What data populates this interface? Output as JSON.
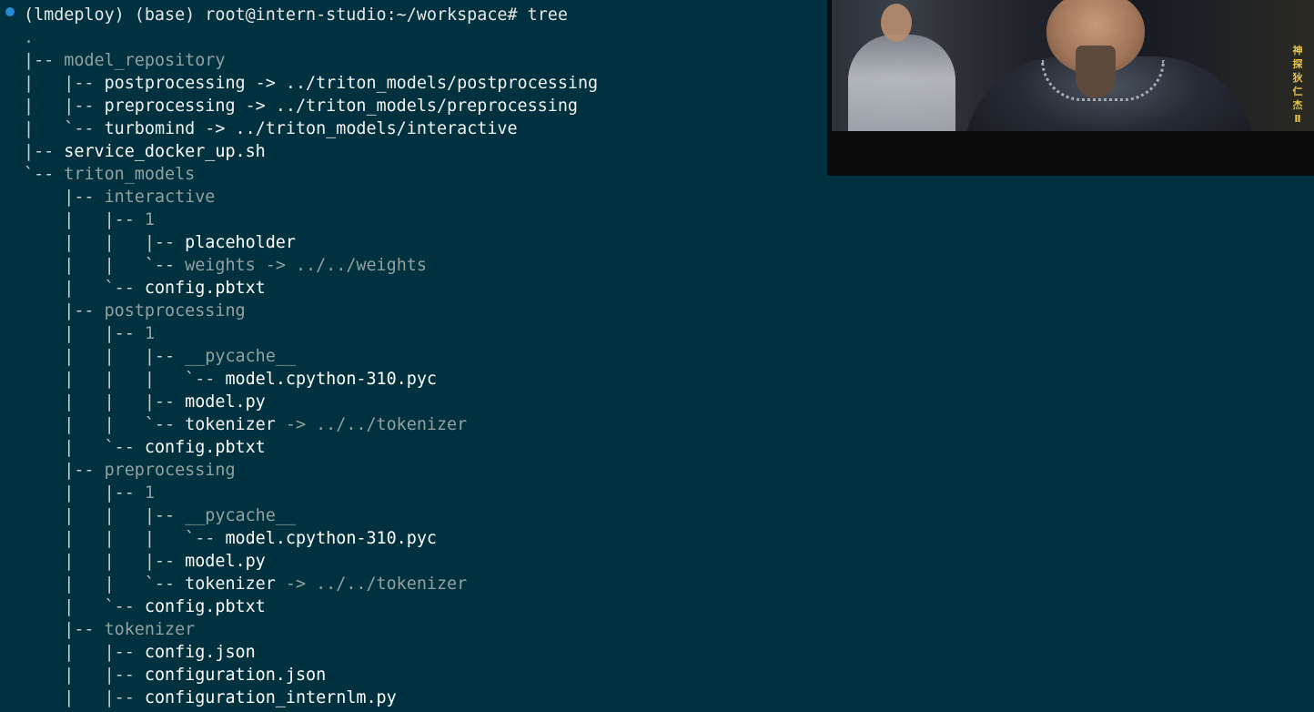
{
  "terminal": {
    "prompt": "(lmdeploy) (base) root@intern-studio:~/workspace#",
    "command": "tree",
    "lines": [
      [
        {
          "t": ".",
          "c": "dot"
        }
      ],
      [
        {
          "t": "|-- ",
          "c": "branch"
        },
        {
          "t": "model_repository",
          "c": "dir"
        }
      ],
      [
        {
          "t": "|   |-- ",
          "c": "branch"
        },
        {
          "t": "postprocessing",
          "c": "link"
        },
        {
          "t": " -> ",
          "c": "link"
        },
        {
          "t": "../triton_models/postprocessing",
          "c": "link"
        }
      ],
      [
        {
          "t": "|   |-- ",
          "c": "branch"
        },
        {
          "t": "preprocessing",
          "c": "link"
        },
        {
          "t": " -> ",
          "c": "link"
        },
        {
          "t": "../triton_models/preprocessing",
          "c": "link"
        }
      ],
      [
        {
          "t": "|   `-- ",
          "c": "branch"
        },
        {
          "t": "turbomind",
          "c": "link"
        },
        {
          "t": " -> ",
          "c": "link"
        },
        {
          "t": "../triton_models/interactive",
          "c": "link"
        }
      ],
      [
        {
          "t": "|-- ",
          "c": "branch"
        },
        {
          "t": "service_docker_up.sh",
          "c": "file"
        }
      ],
      [
        {
          "t": "`-- ",
          "c": "branch"
        },
        {
          "t": "triton_models",
          "c": "dir"
        }
      ],
      [
        {
          "t": "    |-- ",
          "c": "branch"
        },
        {
          "t": "interactive",
          "c": "dir"
        }
      ],
      [
        {
          "t": "    |   |-- ",
          "c": "branch"
        },
        {
          "t": "1",
          "c": "dir"
        }
      ],
      [
        {
          "t": "    |   |   |-- ",
          "c": "branch"
        },
        {
          "t": "placeholder",
          "c": "file"
        }
      ],
      [
        {
          "t": "    |   |   `-- ",
          "c": "branch"
        },
        {
          "t": "weights",
          "c": "dir"
        },
        {
          "t": " -> ",
          "c": "dir"
        },
        {
          "t": "../../weights",
          "c": "target"
        }
      ],
      [
        {
          "t": "    |   `-- ",
          "c": "branch"
        },
        {
          "t": "config.pbtxt",
          "c": "file"
        }
      ],
      [
        {
          "t": "    |-- ",
          "c": "branch"
        },
        {
          "t": "postprocessing",
          "c": "dir"
        }
      ],
      [
        {
          "t": "    |   |-- ",
          "c": "branch"
        },
        {
          "t": "1",
          "c": "dir"
        }
      ],
      [
        {
          "t": "    |   |   |-- ",
          "c": "branch"
        },
        {
          "t": "__pycache__",
          "c": "dir"
        }
      ],
      [
        {
          "t": "    |   |   |   `-- ",
          "c": "branch"
        },
        {
          "t": "model.cpython-310.pyc",
          "c": "file"
        }
      ],
      [
        {
          "t": "    |   |   |-- ",
          "c": "branch"
        },
        {
          "t": "model.py",
          "c": "file"
        }
      ],
      [
        {
          "t": "    |   |   `-- ",
          "c": "branch"
        },
        {
          "t": "tokenizer",
          "c": "link"
        },
        {
          "t": " -> ",
          "c": "target"
        },
        {
          "t": "../../tokenizer",
          "c": "target"
        }
      ],
      [
        {
          "t": "    |   `-- ",
          "c": "branch"
        },
        {
          "t": "config.pbtxt",
          "c": "file"
        }
      ],
      [
        {
          "t": "    |-- ",
          "c": "branch"
        },
        {
          "t": "preprocessing",
          "c": "dir"
        }
      ],
      [
        {
          "t": "    |   |-- ",
          "c": "branch"
        },
        {
          "t": "1",
          "c": "dir"
        }
      ],
      [
        {
          "t": "    |   |   |-- ",
          "c": "branch"
        },
        {
          "t": "__pycache__",
          "c": "dir"
        }
      ],
      [
        {
          "t": "    |   |   |   `-- ",
          "c": "branch"
        },
        {
          "t": "model.cpython-310.pyc",
          "c": "file"
        }
      ],
      [
        {
          "t": "    |   |   |-- ",
          "c": "branch"
        },
        {
          "t": "model.py",
          "c": "file"
        }
      ],
      [
        {
          "t": "    |   |   `-- ",
          "c": "branch"
        },
        {
          "t": "tokenizer",
          "c": "link"
        },
        {
          "t": " -> ",
          "c": "target"
        },
        {
          "t": "../../tokenizer",
          "c": "target"
        }
      ],
      [
        {
          "t": "    |   `-- ",
          "c": "branch"
        },
        {
          "t": "config.pbtxt",
          "c": "file"
        }
      ],
      [
        {
          "t": "    |-- ",
          "c": "branch"
        },
        {
          "t": "tokenizer",
          "c": "dir"
        }
      ],
      [
        {
          "t": "    |   |-- ",
          "c": "branch"
        },
        {
          "t": "config.json",
          "c": "file"
        }
      ],
      [
        {
          "t": "    |   |-- ",
          "c": "branch"
        },
        {
          "t": "configuration.json",
          "c": "file"
        }
      ],
      [
        {
          "t": "    |   |-- ",
          "c": "branch"
        },
        {
          "t": "configuration_internlm.py",
          "c": "file"
        }
      ]
    ]
  },
  "video_overlay": {
    "caption": "神探狄仁杰Ⅱ"
  },
  "colors": {
    "background": "#00313f",
    "prompt_dot": "#268bd2"
  }
}
